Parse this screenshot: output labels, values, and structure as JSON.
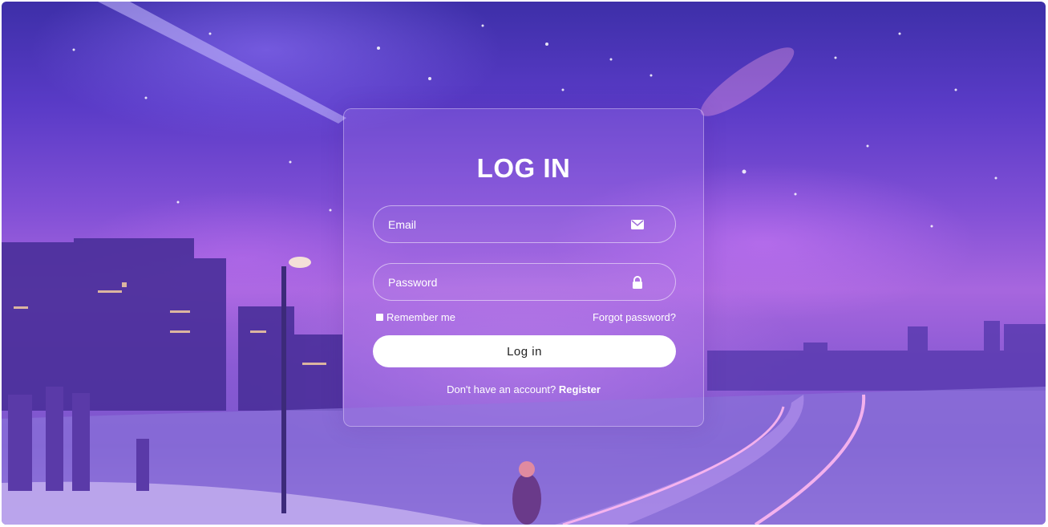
{
  "login": {
    "title": "LOG IN",
    "email_placeholder": "Email",
    "password_placeholder": "Password",
    "remember_label": "Remember me",
    "forgot_label": "Forgot password?",
    "login_button": "Log in",
    "no_account_text": "Don't have an account? ",
    "register_label": "Register"
  },
  "icons": {
    "email": "envelope-icon",
    "password": "lock-icon"
  },
  "colors": {
    "accent": "#ffffff",
    "background_top": "#3d2fa8",
    "background_mid": "#a766de"
  }
}
